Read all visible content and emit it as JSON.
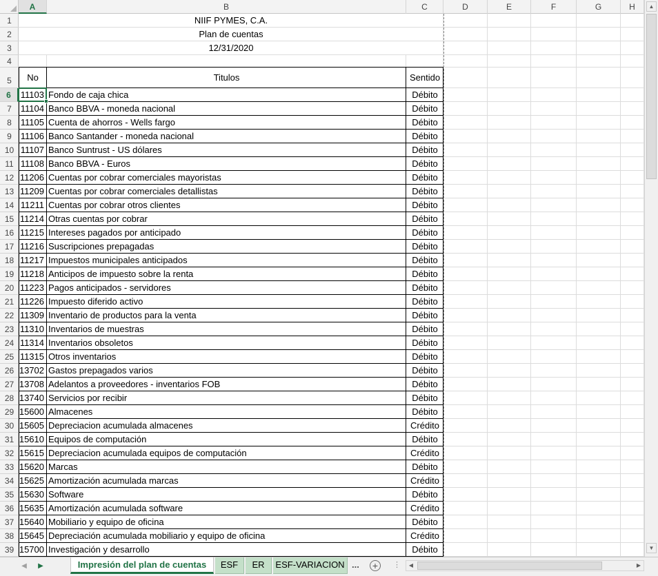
{
  "columns": [
    {
      "label": "A",
      "w": 41
    },
    {
      "label": "B",
      "w": 521
    },
    {
      "label": "C",
      "w": 54
    },
    {
      "label": "D",
      "w": 64
    },
    {
      "label": "E",
      "w": 63
    },
    {
      "label": "F",
      "w": 66
    },
    {
      "label": "G",
      "w": 64
    },
    {
      "label": "H",
      "w": 34
    }
  ],
  "selected_column": "A",
  "selected_row": "6",
  "header": {
    "company": "NIIF PYMES, C.A.",
    "title": "Plan de cuentas",
    "date": "12/31/2020",
    "col_no": "No",
    "col_titulos": "Titulos",
    "col_sentido": "Sentido"
  },
  "rows": [
    {
      "n": "6",
      "no": "11103",
      "title": "Fondo de caja chica",
      "sentido": "Débito"
    },
    {
      "n": "7",
      "no": "11104",
      "title": "Banco BBVA - moneda nacional",
      "sentido": "Débito"
    },
    {
      "n": "8",
      "no": "11105",
      "title": "Cuenta de ahorros - Wells fargo",
      "sentido": "Débito"
    },
    {
      "n": "9",
      "no": "11106",
      "title": "Banco Santander - moneda nacional",
      "sentido": "Débito"
    },
    {
      "n": "10",
      "no": "11107",
      "title": "Banco Suntrust - US dólares",
      "sentido": "Débito"
    },
    {
      "n": "11",
      "no": "11108",
      "title": "Banco BBVA - Euros",
      "sentido": "Débito"
    },
    {
      "n": "12",
      "no": "11206",
      "title": "Cuentas por cobrar comerciales mayoristas",
      "sentido": "Débito"
    },
    {
      "n": "13",
      "no": "11209",
      "title": "Cuentas por cobrar comerciales detallistas",
      "sentido": "Débito"
    },
    {
      "n": "14",
      "no": "11211",
      "title": "Cuentas por cobrar otros clientes",
      "sentido": "Débito"
    },
    {
      "n": "15",
      "no": "11214",
      "title": "Otras cuentas por cobrar",
      "sentido": "Débito"
    },
    {
      "n": "16",
      "no": "11215",
      "title": "Intereses pagados por anticipado",
      "sentido": "Débito"
    },
    {
      "n": "17",
      "no": "11216",
      "title": "Suscripciones prepagadas",
      "sentido": "Débito"
    },
    {
      "n": "18",
      "no": "11217",
      "title": "Impuestos municipales anticipados",
      "sentido": "Débito"
    },
    {
      "n": "19",
      "no": "11218",
      "title": "Anticipos de impuesto sobre la renta",
      "sentido": "Débito"
    },
    {
      "n": "20",
      "no": "11223",
      "title": "Pagos anticipados - servidores",
      "sentido": "Débito"
    },
    {
      "n": "21",
      "no": "11226",
      "title": "Impuesto diferido activo",
      "sentido": "Débito"
    },
    {
      "n": "22",
      "no": "11309",
      "title": "Inventario de productos para la venta",
      "sentido": "Débito"
    },
    {
      "n": "23",
      "no": "11310",
      "title": "Inventarios de muestras",
      "sentido": "Débito"
    },
    {
      "n": "24",
      "no": "11314",
      "title": "Inventarios obsoletos",
      "sentido": "Débito"
    },
    {
      "n": "25",
      "no": "11315",
      "title": "Otros inventarios",
      "sentido": "Débito"
    },
    {
      "n": "26",
      "no": "13702",
      "title": "Gastos prepagados varios",
      "sentido": "Débito"
    },
    {
      "n": "27",
      "no": "13708",
      "title": "Adelantos a proveedores - inventarios FOB",
      "sentido": "Débito"
    },
    {
      "n": "28",
      "no": "13740",
      "title": "Servicios por recibir",
      "sentido": "Débito"
    },
    {
      "n": "29",
      "no": "15600",
      "title": "Almacenes",
      "sentido": "Débito"
    },
    {
      "n": "30",
      "no": "15605",
      "title": "Depreciacion acumulada almacenes",
      "sentido": "Crédito"
    },
    {
      "n": "31",
      "no": "15610",
      "title": "Equipos de computación",
      "sentido": "Débito"
    },
    {
      "n": "32",
      "no": "15615",
      "title": "Depreciacion acumulada equipos de computación",
      "sentido": "Crédito"
    },
    {
      "n": "33",
      "no": "15620",
      "title": "Marcas",
      "sentido": "Débito"
    },
    {
      "n": "34",
      "no": "15625",
      "title": "Amortización acumulada marcas",
      "sentido": "Crédito"
    },
    {
      "n": "35",
      "no": "15630",
      "title": "Software",
      "sentido": "Débito"
    },
    {
      "n": "36",
      "no": "15635",
      "title": "Amortización acumulada software",
      "sentido": "Crédito"
    },
    {
      "n": "37",
      "no": "15640",
      "title": "Mobiliario y equipo de oficina",
      "sentido": "Débito"
    },
    {
      "n": "38",
      "no": "15645",
      "title": "Depreciación acumulada mobiliario y equipo de oficina",
      "sentido": "Crédito"
    },
    {
      "n": "39",
      "no": "15700",
      "title": "Investigación y desarrollo",
      "sentido": "Débito"
    }
  ],
  "sheet_tabs": [
    {
      "label": "Impresión del plan de cuentas",
      "active": true
    },
    {
      "label": "ESF",
      "active": false
    },
    {
      "label": "ER",
      "active": false
    },
    {
      "label": "ESF-VARIACION",
      "active": false
    }
  ],
  "tab_overflow": "...",
  "add_sheet": "+",
  "accent_color": "#217346",
  "tab_color": "#c4e0c9"
}
